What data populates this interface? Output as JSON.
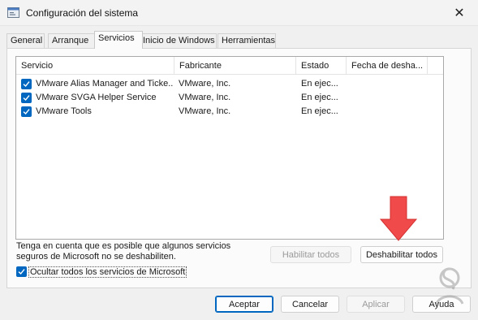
{
  "window": {
    "title": "Configuración del sistema",
    "close_glyph": "✕"
  },
  "tabs": [
    {
      "label": "General"
    },
    {
      "label": "Arranque"
    },
    {
      "label": "Servicios"
    },
    {
      "label": "Inicio de Windows"
    },
    {
      "label": "Herramientas"
    }
  ],
  "services": {
    "columns": [
      "Servicio",
      "Fabricante",
      "Estado",
      "Fecha de desha..."
    ],
    "rows": [
      {
        "service": "VMware Alias Manager and Ticke...",
        "manufacturer": "VMware, Inc.",
        "status": "En ejec...",
        "checked": true
      },
      {
        "service": "VMware SVGA Helper Service",
        "manufacturer": "VMware, Inc.",
        "status": "En ejec...",
        "checked": true
      },
      {
        "service": "VMware Tools",
        "manufacturer": "VMware, Inc.",
        "status": "En ejec...",
        "checked": true
      }
    ]
  },
  "note": "Tenga en cuenta que es posible que algunos servicios seguros de Microsoft no se deshabiliten.",
  "buttons": {
    "enable_all": "Habilitar todos",
    "disable_all": "Deshabilitar todos",
    "ok": "Aceptar",
    "cancel": "Cancelar",
    "apply": "Aplicar",
    "help": "Ayuda"
  },
  "hide_ms": {
    "label": "Ocultar todos los servicios de Microsoft",
    "checked": true
  },
  "colors": {
    "accent": "#0067c0",
    "arrow": "#f04a4a"
  }
}
